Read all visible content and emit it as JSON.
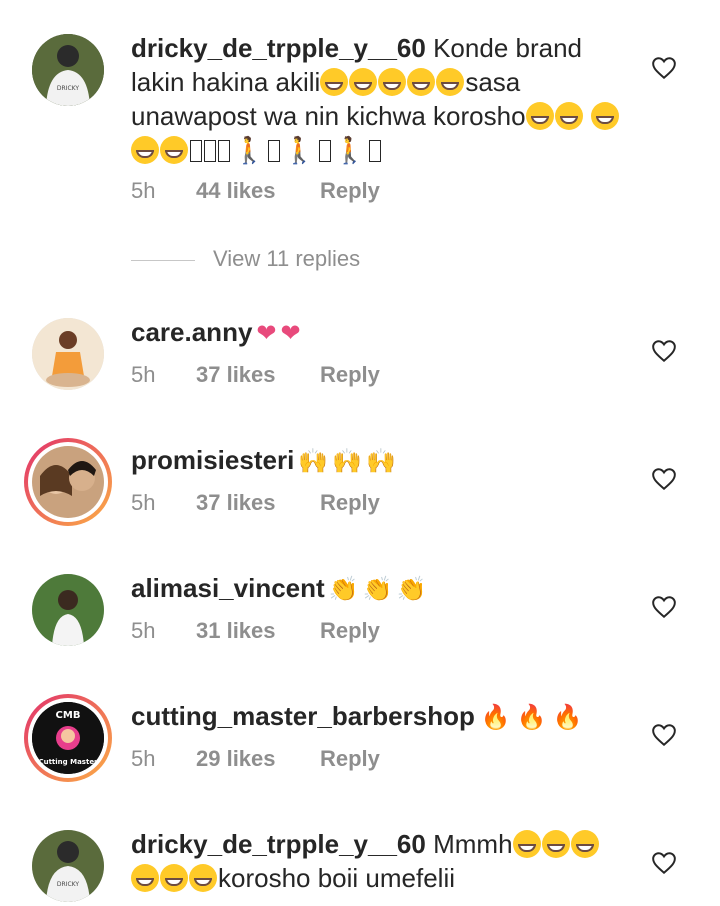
{
  "comments": [
    {
      "username": "dricky_de_trpple_y__60",
      "text_parts": [
        "Konde brand lakin hakina akili",
        "sasa unawapost wa nin kichwa korosho"
      ],
      "time": "5h",
      "likes": "44 likes",
      "reply": "Reply",
      "avatar_text": "DRICKY"
    },
    {
      "username": "care.anny",
      "text": "",
      "time": "5h",
      "likes": "37 likes",
      "reply": "Reply"
    },
    {
      "username": "promisiesteri",
      "text": "",
      "time": "5h",
      "likes": "37 likes",
      "reply": "Reply"
    },
    {
      "username": "alimasi_vincent",
      "text": "",
      "time": "5h",
      "likes": "31 likes",
      "reply": "Reply"
    },
    {
      "username": "cutting_master_barbershop",
      "text": "",
      "time": "5h",
      "likes": "29 likes",
      "reply": "Reply",
      "avatar_text": "Cutting Master",
      "avatar_badge": "CMB"
    },
    {
      "username": "dricky_de_trpple_y__60",
      "text_parts": [
        "Mmmh",
        "korosho boii umefelii"
      ],
      "avatar_text": "DRICKY"
    }
  ],
  "view_replies": "View 11 replies",
  "colors": {
    "text": "#262626",
    "muted": "#8e8e8e",
    "story_ring_start": "#e1306c",
    "story_ring_end": "#fcaf45"
  },
  "icons": {
    "like": "heart-outline-icon"
  }
}
